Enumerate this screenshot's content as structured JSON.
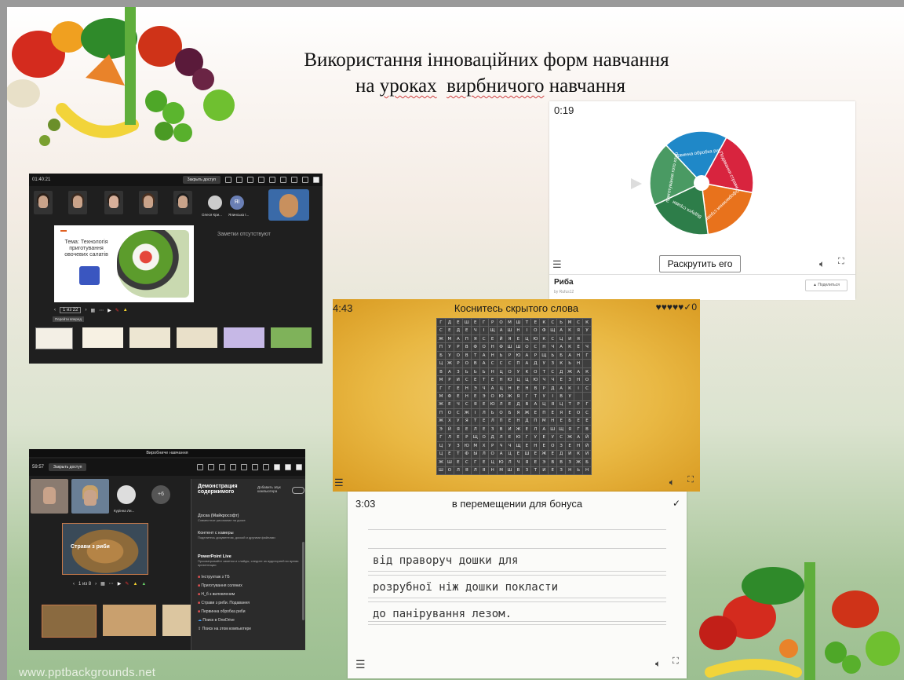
{
  "slide": {
    "title_line1": "Використання інноваційних форм навчання",
    "title_line2_prefix": "на ",
    "title_line2_u1": "уроках",
    "title_line2_mid": "  ",
    "title_line2_u2": "вирбничого",
    "title_line2_suffix": " навчання",
    "watermark": "www.pptbackgrounds.net"
  },
  "teams1": {
    "time": "01:40:21",
    "share_label": "Закрыть доступ",
    "toolbar": [
      "Макет",
      "Контент оу",
      "Контакты",
      "Участники",
      "Чат",
      "Реакции",
      "Комнаты",
      "Еще",
      "Камера"
    ],
    "participants": [
      "Олеся Кри...",
      "Ялинська І..."
    ],
    "avatar_initials": "ЯІ",
    "slide_title": "Тема: Технологія приготування овочевих салатів",
    "notes": "Заметки отсутствуют",
    "page_indicator": "1 из 22",
    "tooltip": "Перейти вперед"
  },
  "teams2": {
    "window_title": "Виробниче навчання",
    "time": "59:57",
    "share_label": "Закрыть доступ",
    "toolbar": [
      "Макет",
      "Личный пр...",
      "Контент",
      "Участники",
      "Чат",
      "Реакции",
      "Еще",
      "Камера",
      "Микрофон",
      "Поделиться"
    ],
    "participant_name": "Курінна Ли...",
    "extra_count": "+6",
    "slide_label": "Страви з риби",
    "page_indicator": "1 из 8",
    "panel": {
      "heading": "Демонстрация содержимого",
      "include_audio": "Добавить звук компьютера",
      "whiteboard": "Доска (Майкрософт)",
      "whiteboard_sub": "Совместное рисование на доске",
      "camera": "Контент с камеры",
      "camera_sub": "Поделитесь документом, доской и другими файлами",
      "pp_live": "PowerPoint Live",
      "pp_live_sub": "Просматривайте заметки и слайды, следите за аудиторией во время презентации",
      "files": [
        "Інструктаж з ТБ",
        "Приготування соляних",
        "Н_б з виловленим",
        "Страви з риби. Подавання",
        "Первинна обробка риби"
      ],
      "onedrive": "Поиск в OneDrive",
      "computer": "Поиск на этом компьютере"
    }
  },
  "wheel": {
    "timer": "0:19",
    "spin_label": "Раскрутить его",
    "segments": [
      {
        "label": "Первинна обробка риби",
        "color": "#1f88c8"
      },
      {
        "label": "Подавання страви",
        "color": "#d8243e"
      },
      {
        "label": "Оформлення страви",
        "color": "#e8721c"
      },
      {
        "label": "Відпуск страви",
        "color": "#2d7d49"
      },
      {
        "label": "приготування гото клар",
        "color": "#4a9a63"
      }
    ],
    "footer_title": "Риба",
    "footer_sub": "by Rufus12",
    "share_label": "Поделиться"
  },
  "wordsearch": {
    "timer": "4:43",
    "title": "Коснитесь скрытого слова",
    "hearts": "♥♥♥♥♥",
    "score": "✓0",
    "rows": [
      "ГДЕШЕГРОМШТЕКСЬМСК",
      "СЕДЕЧІЩАШНІОФЩАКЯУ",
      "ЖМАПЯСЕЙЯЕЦЮКСЦИЯ",
      "ПУРВФОНФШШОСНЧАКЕЧ",
      "БУОВТАНЬРЮАРЩЬБАНГЕ",
      "ЦЖРОВАСССПАДУЗКЬН",
      "ВАЗЬЬЬНЦОУКОТСДЖАК",
      "МРИСЕТЕНЮЦЦЮЧЧЕЗНОП",
      "ГГЕНЭЧАЦНЕНВРДАКІС",
      "МФЕНЕЭОЮЖЯГТУІВУ",
      "ЖЕЧСЯЕЮЛЕДВАЦЯЦТРГ",
      "ПОСЖІЛЬОБЯЖЕПЕЯЕОС",
      "ЖХУЯТЕЛПЕНДПМНЕБЕЕП",
      "ЭЙЯЕЛЕЗВИЖЕЛАШЩЯГВ",
      "ГЛЕРЩОДЛЕЮГУЕУСЖАЙ",
      "ЦУЗЮМХРЧЧЩЕНЕОЗЕНЙ",
      "ЦЕТФЫЛОАЦЕШЕЖЕДИКИ",
      "ЖШЕСГЕЦЮЛЧЯЕЭВВЗЖБ",
      "ШОЛЯЛЯНМШВЗТИЕЗНЬН"
    ]
  },
  "textcard": {
    "timer": "3:03",
    "header": "в перемещении для бонуса",
    "lines": [
      "від праворуч дошки для",
      "розрубної ніж дошки покласти",
      "до панірування лезом."
    ]
  }
}
